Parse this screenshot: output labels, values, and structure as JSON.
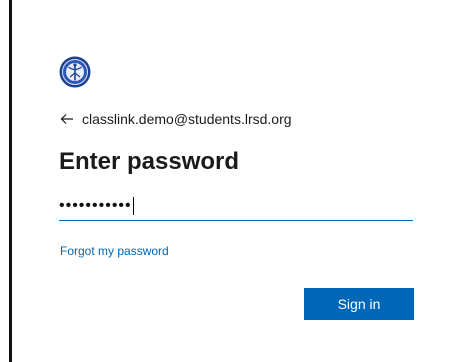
{
  "account": {
    "email": "classlink.demo@students.lrsd.org",
    "back_icon": "back-arrow-icon"
  },
  "logo": {
    "icon": "district-seal-logo"
  },
  "page": {
    "title": "Enter password"
  },
  "password": {
    "masked_value": "•••••••••••"
  },
  "links": {
    "forgot": "Forgot my password"
  },
  "actions": {
    "sign_in": "Sign in"
  },
  "colors": {
    "accent": "#0067b8",
    "text": "#1b1b1b",
    "background": "#ffffff"
  }
}
